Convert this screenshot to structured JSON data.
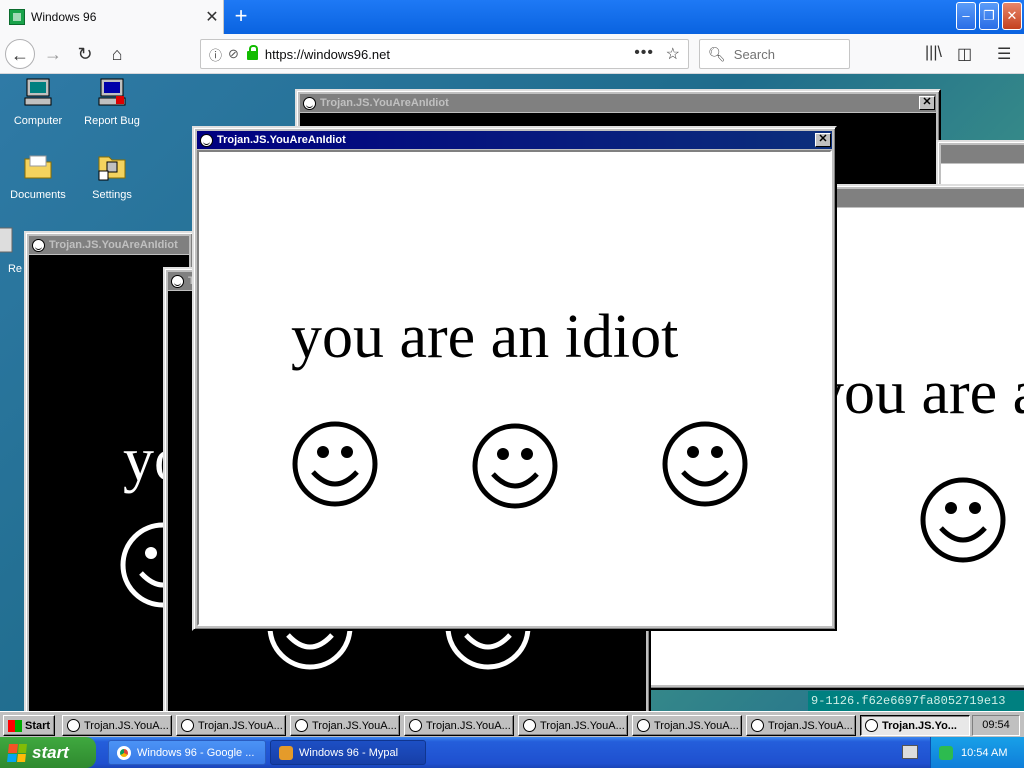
{
  "browser": {
    "tab_title": "Windows 96",
    "url": "https://windows96.net",
    "search_placeholder": "Search"
  },
  "desktop": {
    "icons": [
      {
        "label": "Computer",
        "icon": "computer-icon"
      },
      {
        "label": "Report Bug",
        "icon": "report-bug-icon"
      },
      {
        "label": "Documents",
        "icon": "folder-icon"
      },
      {
        "label": "Settings",
        "icon": "settings-icon"
      },
      {
        "label": "Re",
        "icon": "recycle-icon"
      }
    ]
  },
  "popup": {
    "title": "Trojan.JS.YouAreAnIdiot",
    "message": "you are an idiot"
  },
  "hash_text": "9-1126.f62e6697fa8052719e13",
  "w95_taskbar": {
    "start_label": "Start",
    "buttons": [
      "Trojan.JS.YouA...",
      "Trojan.JS.YouA...",
      "Trojan.JS.YouA...",
      "Trojan.JS.YouA...",
      "Trojan.JS.YouA...",
      "Trojan.JS.YouA...",
      "Trojan.JS.YouA...",
      "Trojan.JS.Yo..."
    ],
    "clock": "09:54"
  },
  "xp_taskbar": {
    "start_label": "start",
    "buttons": [
      "Windows 96 - Google ...",
      "Windows 96 - Mypal"
    ],
    "clock": "10:54 AM"
  },
  "colors": {
    "w95_title_active": "#000080",
    "xp_start": "#3fa93f",
    "desktop": "#2f7aa6"
  }
}
